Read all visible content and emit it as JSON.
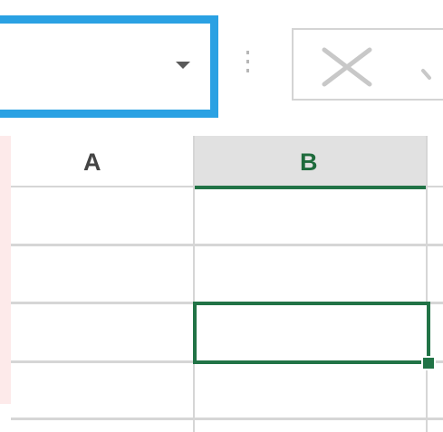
{
  "formula_bar": {
    "name_box_value": "",
    "cancel_icon": "x-icon",
    "enter_icon": "checkmark-icon"
  },
  "sheet": {
    "columns": [
      {
        "label": "A",
        "selected": false
      },
      {
        "label": "B",
        "selected": true
      }
    ],
    "active_cell": {
      "column": "B",
      "row_index": 2
    },
    "colors": {
      "accent_green": "#217346",
      "name_box_border": "#2aa1e3",
      "selected_header_bg": "#e1e1e1",
      "gridline": "#d6d6d6"
    }
  }
}
